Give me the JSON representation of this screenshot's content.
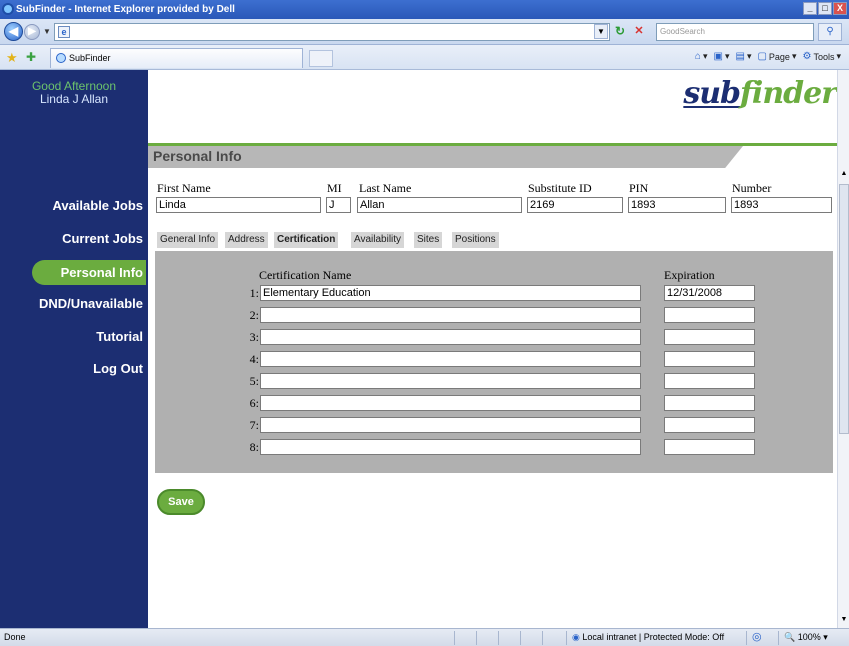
{
  "window": {
    "title": "SubFinder - Internet Explorer provided by Dell",
    "controls": [
      "_",
      "□",
      "X"
    ]
  },
  "addressbar": {
    "url": "",
    "search_placeholder": "GoodSearch"
  },
  "tab": {
    "title": "SubFinder"
  },
  "commandbar": {
    "page_label": "Page",
    "tools_label": "Tools"
  },
  "sidebar": {
    "greeting": "Good Afternoon",
    "user_name": "Linda J Allan",
    "items": [
      {
        "label": "Available Jobs"
      },
      {
        "label": "Current Jobs"
      },
      {
        "label": "Personal Info",
        "active": true
      },
      {
        "label": "DND/Unavailable"
      },
      {
        "label": "Tutorial"
      },
      {
        "label": "Log Out"
      }
    ]
  },
  "brand": {
    "logo_part1": "sub",
    "logo_part2": "finder",
    "registered": "®"
  },
  "section": {
    "title": "Personal Info"
  },
  "personal": {
    "first_name_label": "First Name",
    "first_name": "Linda",
    "mi_label": "MI",
    "mi": "J",
    "last_name_label": "Last Name",
    "last_name": "Allan",
    "sub_id_label": "Substitute ID",
    "sub_id": "2169",
    "pin_label": "PIN",
    "pin": "1893",
    "number_label": "Number",
    "number": "1893"
  },
  "tabs": [
    {
      "label": "General Info"
    },
    {
      "label": "Address"
    },
    {
      "label": "Certification",
      "active": true
    },
    {
      "label": "Availability"
    },
    {
      "label": "Sites"
    },
    {
      "label": "Positions"
    }
  ],
  "certification": {
    "name_header": "Certification Name",
    "expiration_header": "Expiration",
    "rows": [
      {
        "num": "1:",
        "name": "Elementary Education",
        "expiration": "12/31/2008"
      },
      {
        "num": "2:",
        "name": "",
        "expiration": ""
      },
      {
        "num": "3:",
        "name": "",
        "expiration": ""
      },
      {
        "num": "4:",
        "name": "",
        "expiration": ""
      },
      {
        "num": "5:",
        "name": "",
        "expiration": ""
      },
      {
        "num": "6:",
        "name": "",
        "expiration": ""
      },
      {
        "num": "7:",
        "name": "",
        "expiration": ""
      },
      {
        "num": "8:",
        "name": "",
        "expiration": ""
      }
    ]
  },
  "actions": {
    "save_label": "Save"
  },
  "statusbar": {
    "status": "Done",
    "zone": "Local intranet | Protected Mode: Off",
    "zoom": "100%"
  },
  "colors": {
    "sidebar_bg": "#1c2e72",
    "accent_green": "#6bac3f",
    "panel_gray": "#b0b0b0"
  }
}
